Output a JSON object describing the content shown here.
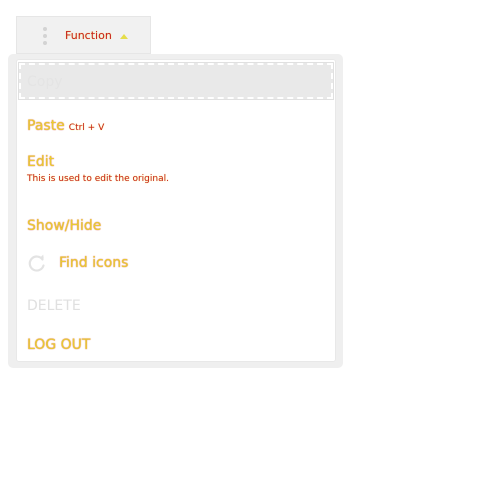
{
  "toolbar": {
    "function_label": "Function",
    "kebab_icon": "more-vertical-icon",
    "caret_icon": "caret-up-icon"
  },
  "menu": {
    "items": [
      {
        "label": "Copy",
        "state": "disabled-hover"
      },
      {
        "label": "Paste",
        "shortcut": "Ctrl + V"
      },
      {
        "label": "Edit",
        "description": "This is used to edit the original."
      },
      {
        "label": "Show/Hide"
      },
      {
        "label": "Find icons",
        "icon": "refresh-icon"
      },
      {
        "label": "DELETE",
        "state": "disabled"
      },
      {
        "label": "LOG OUT"
      }
    ]
  },
  "colors": {
    "label_fill": "#e8cc31",
    "label_glow": "#d2361d",
    "panel_bg": "#efefef"
  }
}
